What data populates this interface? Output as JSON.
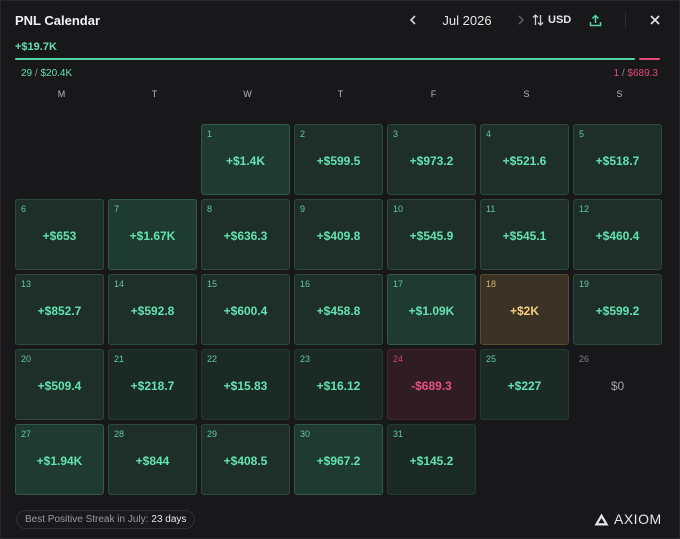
{
  "header": {
    "title": "PNL Calendar",
    "month": "Jul 2026",
    "currency": "USD"
  },
  "summary": {
    "total": "+$19.7K",
    "win_count": "29",
    "win_amount": "$20.4K",
    "loss_count": "1",
    "loss_amount": "$689.3",
    "win_ratio": 0.967
  },
  "weekdays": [
    "M",
    "T",
    "W",
    "T",
    "F",
    "S",
    "S"
  ],
  "days": [
    {
      "day": "1",
      "pnl": "+$1.4K",
      "tone": "t2"
    },
    {
      "day": "2",
      "pnl": "+$599.5",
      "tone": "t1"
    },
    {
      "day": "3",
      "pnl": "+$973.2",
      "tone": "t1"
    },
    {
      "day": "4",
      "pnl": "+$521.6",
      "tone": "t1"
    },
    {
      "day": "5",
      "pnl": "+$518.7",
      "tone": "t1"
    },
    {
      "day": "6",
      "pnl": "+$653",
      "tone": "t1"
    },
    {
      "day": "7",
      "pnl": "+$1.67K",
      "tone": "t2"
    },
    {
      "day": "8",
      "pnl": "+$636.3",
      "tone": "t1"
    },
    {
      "day": "9",
      "pnl": "+$409.8",
      "tone": "t1"
    },
    {
      "day": "10",
      "pnl": "+$545.9",
      "tone": "t1"
    },
    {
      "day": "11",
      "pnl": "+$545.1",
      "tone": "t1"
    },
    {
      "day": "12",
      "pnl": "+$460.4",
      "tone": "t1"
    },
    {
      "day": "13",
      "pnl": "+$852.7",
      "tone": "t1"
    },
    {
      "day": "14",
      "pnl": "+$592.8",
      "tone": "t1"
    },
    {
      "day": "15",
      "pnl": "+$600.4",
      "tone": "t1"
    },
    {
      "day": "16",
      "pnl": "+$458.8",
      "tone": "t1"
    },
    {
      "day": "17",
      "pnl": "+$1.09K",
      "tone": "t2"
    },
    {
      "day": "18",
      "pnl": "+$2K",
      "tone": "gold"
    },
    {
      "day": "19",
      "pnl": "+$599.2",
      "tone": "t1"
    },
    {
      "day": "20",
      "pnl": "+$509.4",
      "tone": "t1"
    },
    {
      "day": "21",
      "pnl": "+$218.7",
      "tone": "t0"
    },
    {
      "day": "22",
      "pnl": "+$15.83",
      "tone": "t0"
    },
    {
      "day": "23",
      "pnl": "+$16.12",
      "tone": "t0"
    },
    {
      "day": "24",
      "pnl": "-$689.3",
      "tone": "red"
    },
    {
      "day": "25",
      "pnl": "+$227",
      "tone": "t0"
    },
    {
      "day": "26",
      "pnl": "$0",
      "tone": "zero"
    },
    {
      "day": "27",
      "pnl": "+$1.94K",
      "tone": "t2"
    },
    {
      "day": "28",
      "pnl": "+$844",
      "tone": "t1"
    },
    {
      "day": "29",
      "pnl": "+$408.5",
      "tone": "t1"
    },
    {
      "day": "30",
      "pnl": "+$967.2",
      "tone": "t2"
    },
    {
      "day": "31",
      "pnl": "+$145.2",
      "tone": "t0"
    }
  ],
  "footer": {
    "streak_label": "Best Positive Streak in July:",
    "streak_value": "23 days",
    "logo": "AXIOM"
  },
  "icons": [
    "chevron-left-icon",
    "chevron-right-icon",
    "swap-vertical-icon",
    "share-icon",
    "close-icon",
    "axiom-logo-icon"
  ]
}
